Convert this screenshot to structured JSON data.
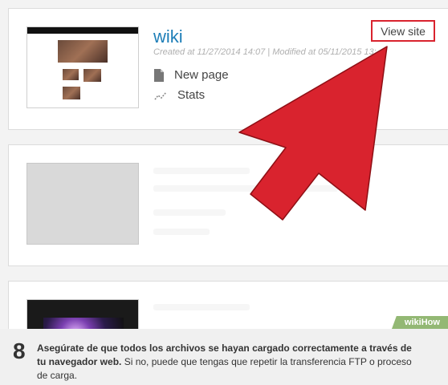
{
  "sites": [
    {
      "title": "wiki",
      "meta": "Created at 11/27/2014 14:07 | Modified at 05/11/2015 13:",
      "actions": [
        {
          "label": "New page",
          "icon": "page-icon"
        },
        {
          "label": "Stats",
          "icon": "stats-icon"
        }
      ],
      "view_site_label": "View site"
    }
  ],
  "step": {
    "number": "8",
    "bold_text": "Asegúrate de que todos los archivos se hayan cargado correctamente a través de tu navegador web.",
    "normal_text": " Si no, puede que tengas que repetir la transferencia FTP o proceso de carga."
  },
  "watermark": "wikiHow",
  "colors": {
    "arrow": "#d9232e",
    "title_link": "#1f7fb8",
    "highlight_box": "#d9232e"
  }
}
